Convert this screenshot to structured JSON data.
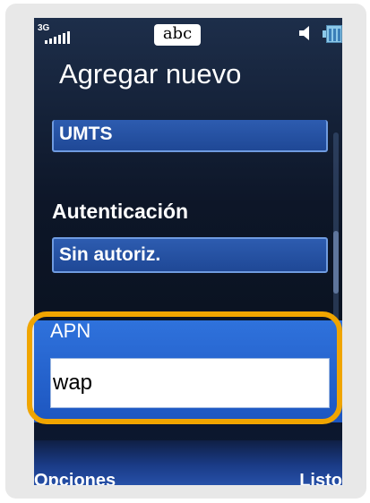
{
  "status_bar": {
    "network_type": "3G",
    "input_mode": "abc",
    "icons": [
      "signal-strength-icon",
      "speaker-icon",
      "battery-icon"
    ]
  },
  "screen": {
    "title": "Agregar nuevo"
  },
  "form": {
    "network_value": "UMTS",
    "auth_label": "Autenticación",
    "auth_value": "Sin autoriz.",
    "apn_label": "APN",
    "apn_value": "wap"
  },
  "softkeys": {
    "left": "Opciones",
    "right": "Listo"
  },
  "colors": {
    "highlight_ring": "#f0a500",
    "field_blue": "#2d5cb0",
    "selected_panel": "#2f72dc"
  }
}
